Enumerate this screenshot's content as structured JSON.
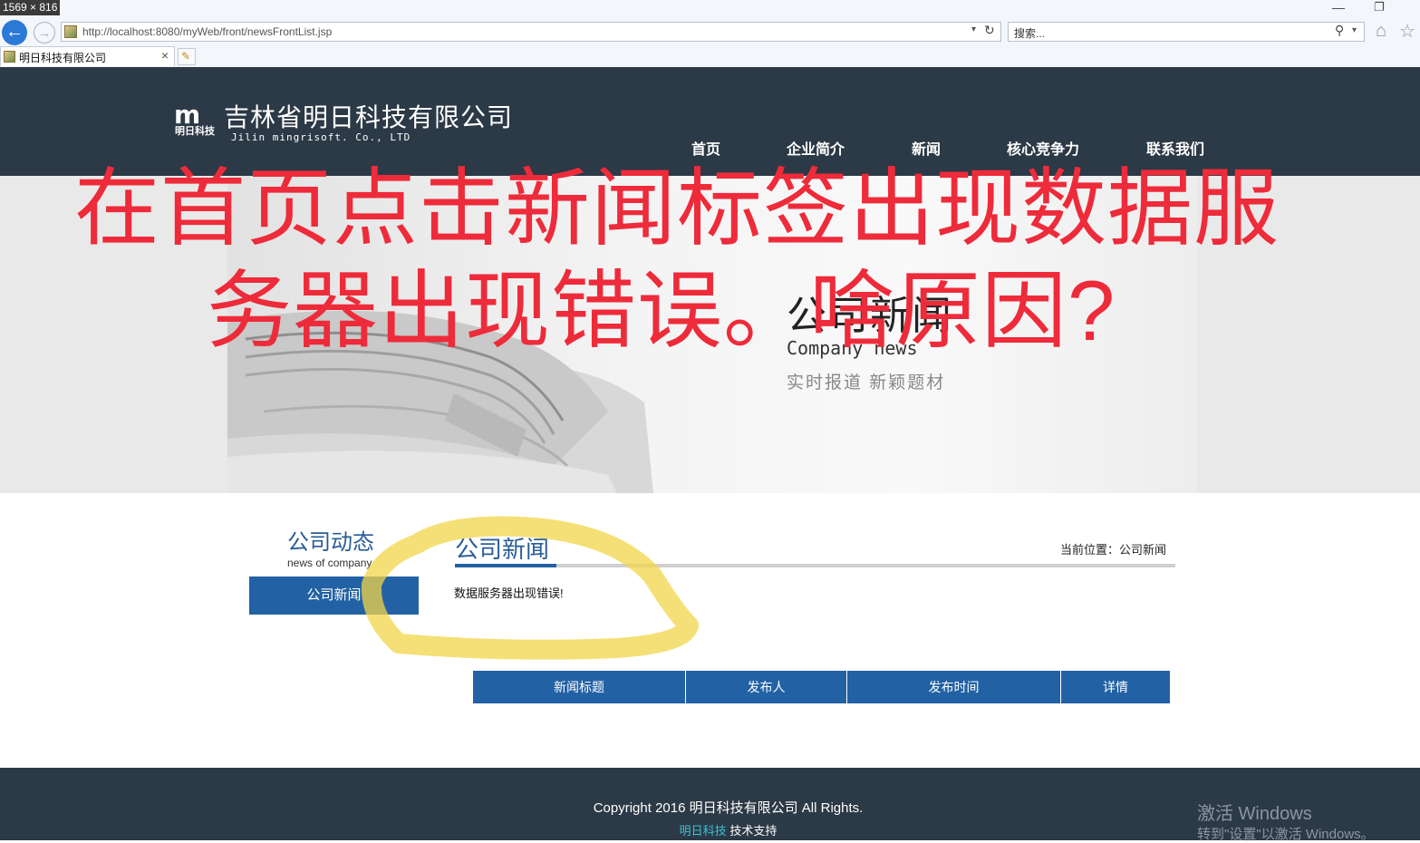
{
  "browser": {
    "dimension_badge": "1569 × 816",
    "url": "http://localhost:8080/myWeb/front/newsFrontList.jsp",
    "search_placeholder": "搜索...",
    "tab_title": "明日科技有限公司",
    "icons": [
      "back-icon",
      "forward-icon",
      "page-favicon",
      "dropdown-icon",
      "refresh-icon",
      "search-icon",
      "home-icon",
      "favorites-star-icon",
      "minimize-icon",
      "restore-icon",
      "close-tab-icon",
      "new-tab-icon"
    ]
  },
  "header": {
    "logo_mark": "m",
    "logo_text_small": "明日科技",
    "company_name": "吉林省明日科技有限公司",
    "company_en": "Jilin mingrisoft. Co., LTD",
    "nav": [
      {
        "label": "首页"
      },
      {
        "label": "企业简介"
      },
      {
        "label": "新闻"
      },
      {
        "label": "核心竞争力"
      },
      {
        "label": "联系我们"
      }
    ]
  },
  "banner": {
    "title": "公司新闻",
    "title_en": "Company news",
    "subtitle": "实时报道 新颖题材"
  },
  "annotation": {
    "line1": "在首页点击新闻标签出现数据服",
    "line2": "务器出现错误。啥原因?",
    "color": "#ee2b3a",
    "highlight_color": "#f2d54a"
  },
  "sidebar": {
    "title": "公司动态",
    "subtitle": "news of company",
    "button_label": "公司新闻"
  },
  "main": {
    "title": "公司新闻",
    "breadcrumb": "当前位置：公司新闻",
    "error_message": "数据服务器出现错误!",
    "table_headers": [
      "新闻标题",
      "发布人",
      "发布时间",
      "详情"
    ]
  },
  "footer": {
    "copyright": "Copyright 2016 明日科技有限公司 All Rights.",
    "support_brand": "明日科技",
    "support_text": "技术支持"
  },
  "watermark": {
    "line1": "激活 Windows",
    "line2": "转到\"设置\"以激活 Windows。"
  },
  "colors": {
    "header_bg": "#2c3946",
    "accent_blue": "#2261a4",
    "title_blue": "#2a5c96"
  }
}
